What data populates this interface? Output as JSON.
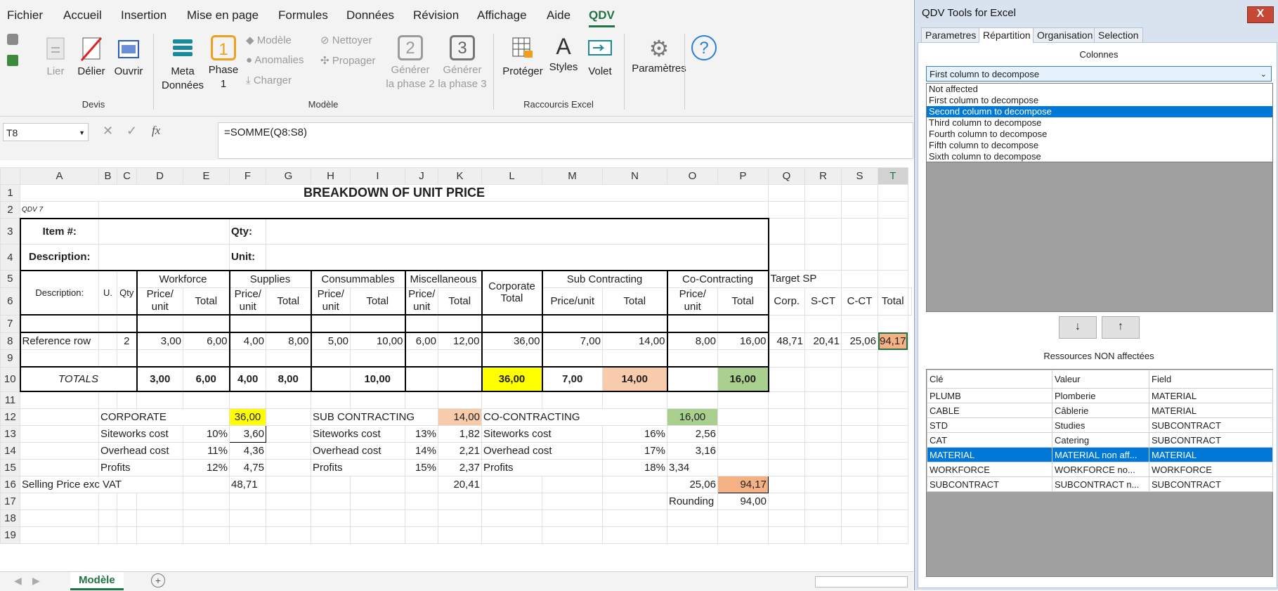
{
  "menu": [
    "Fichier",
    "Accueil",
    "Insertion",
    "Mise en page",
    "Formules",
    "Données",
    "Révision",
    "Affichage",
    "Aide",
    "QDV"
  ],
  "ribbon": {
    "lier": "Lier",
    "delier": "Délier",
    "ouvrir": "Ouvrir",
    "meta1": "Meta",
    "meta2": "Données",
    "phase1a": "Phase",
    "phase1b": "1",
    "modele": "Modèle",
    "anomalies": "Anomalies",
    "charger": "Charger",
    "nettoyer": "Nettoyer",
    "propager": "Propager",
    "gen2a": "Générer",
    "gen2b": "la phase 2",
    "gen3a": "Générer",
    "gen3b": "la phase 3",
    "proteger": "Protéger",
    "styles": "Styles",
    "volet": "Volet",
    "parametres": "Paramètres",
    "grp_devis": "Devis",
    "grp_modele": "Modèle",
    "grp_raccourcis": "Raccourcis Excel",
    "num2": "2",
    "num3": "3"
  },
  "formula_bar": {
    "cell": "T8",
    "fx": "fx",
    "formula": "=SOMME(Q8:S8)"
  },
  "columns": [
    "A",
    "B",
    "C",
    "D",
    "E",
    "F",
    "G",
    "H",
    "I",
    "J",
    "K",
    "L",
    "M",
    "N",
    "O",
    "P",
    "Q",
    "R",
    "S",
    "T"
  ],
  "sheet": {
    "title": "BREAKDOWN OF UNIT PRICE",
    "qdv": "QDV 7",
    "item": "Item #:",
    "qty": "Qty:",
    "desc": "Description:",
    "unit": "Unit:",
    "hdr_desc": "Description:",
    "hdr_u": "U.",
    "hdr_qty": "Qty",
    "workforce": "Workforce",
    "supplies": "Supplies",
    "consumables": "Consummables",
    "misc": "Miscellaneous",
    "corporate_total": "Corporate Total",
    "subcontracting": "Sub Contracting",
    "cocontracting": "Co-Contracting",
    "target": "Target SP",
    "price_unit": "Price/ unit",
    "total": "Total",
    "price_unit2": "Price/unit",
    "corp": "Corp.",
    "sct": "S-CT",
    "cct": "C-CT",
    "ref": {
      "label": "Reference row",
      "qty": "2",
      "d": "3,00",
      "e": "6,00",
      "f": "4,00",
      "g": "8,00",
      "h": "5,00",
      "i": "10,00",
      "j": "6,00",
      "k": "12,00",
      "l": "36,00",
      "m": "7,00",
      "n": "14,00",
      "o": "8,00",
      "p": "16,00",
      "q": "48,71",
      "r": "20,41",
      "s": "25,06",
      "t": "94,17"
    },
    "totals": {
      "label": "TOTALS",
      "d": "3,00",
      "e": "6,00",
      "f": "4,00",
      "g": "8,00",
      "i": "10,00",
      "l": "36,00",
      "m": "7,00",
      "n": "14,00",
      "p": "16,00"
    },
    "corp_block": {
      "title": "CORPORATE",
      "site": "Siteworks cost",
      "over": "Overhead cost",
      "prof": "Profits",
      "p1": "10%",
      "p2": "11%",
      "p3": "12%",
      "v0": "36,00",
      "v1": "3,60",
      "v2": "4,36",
      "v3": "4,75",
      "sp": "48,71"
    },
    "sub_block": {
      "title": "SUB CONTRACTING",
      "site": "Siteworks cost",
      "over": "Overhead cost",
      "prof": "Profits",
      "p1": "13%",
      "p2": "14%",
      "p3": "15%",
      "v0": "14,00",
      "v1": "1,82",
      "v2": "2,21",
      "v3": "2,37",
      "sp": "20,41"
    },
    "co_block": {
      "title": "CO-CONTRACTING",
      "site": "Siteworks cost",
      "over": "Overhead cost",
      "prof": "Profits",
      "p1": "16%",
      "p2": "17%",
      "p3": "18%",
      "v0": "16,00",
      "v1": "2,56",
      "v2": "3,16",
      "v3": "3,34",
      "sp": "25,06"
    },
    "selling": "Selling Price  exc VAT",
    "final": "94,17",
    "rounding": "Rounding",
    "rounded": "94,00"
  },
  "sheet_tab": "Modèle",
  "panel": {
    "title": "QDV Tools for Excel",
    "close": "X",
    "tabs": [
      "Parametres",
      "Répartition",
      "Organisation",
      "Selection"
    ],
    "colonnes": "Colonnes",
    "dropdown_value": "First column to decompose",
    "options": [
      "Not affected",
      "First column to decompose",
      "Second column to decompose",
      "Third column to decompose",
      "Fourth column to decompose",
      "Fifth column to decompose",
      "Sixth column to decompose"
    ],
    "down": "↓",
    "up": "↑",
    "ressources": "Ressources NON affectées",
    "res_headers": [
      "Clé",
      "Valeur",
      "Field"
    ],
    "res_rows": [
      [
        "PLUMB",
        "Plomberie",
        "MATERIAL"
      ],
      [
        "CABLE",
        "Câblerie",
        "MATERIAL"
      ],
      [
        "STD",
        "Studies",
        "SUBCONTRACT"
      ],
      [
        "CAT",
        "Catering",
        "SUBCONTRACT"
      ],
      [
        "MATERIAL",
        "MATERIAL non aff...",
        "MATERIAL"
      ],
      [
        "WORKFORCE",
        "WORKFORCE no...",
        "WORKFORCE"
      ],
      [
        "SUBCONTRACT",
        "SUBCONTRACT n...",
        "SUBCONTRACT"
      ]
    ]
  },
  "colors": {
    "excel_green": "#217346",
    "yellow": "#ffff00",
    "peach": "#f8cbad",
    "green": "#a9d08e",
    "orange": "#f4b183",
    "select_blue": "#0078d7"
  }
}
